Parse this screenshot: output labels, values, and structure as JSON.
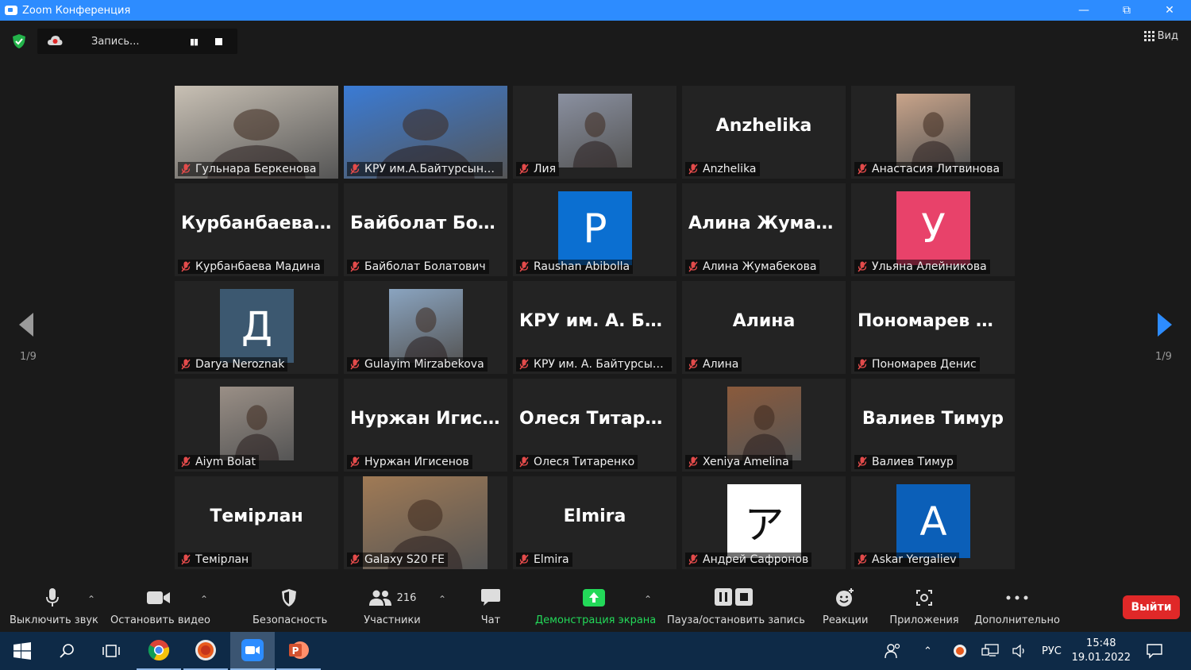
{
  "window": {
    "title": "Zoom Конференция"
  },
  "recording": {
    "label": "Запись..."
  },
  "view": {
    "label": "Вид"
  },
  "pagination": {
    "left": "1/9",
    "right": "1/9"
  },
  "tiles": [
    {
      "name": "Гульнара Беркенова",
      "kind": "photo",
      "bg": "#c8c0b4"
    },
    {
      "name": "КРУ им.А.Байтурсынова Ал...",
      "kind": "photo",
      "bg": "#3a7bd5",
      "active": true
    },
    {
      "name": "Лия",
      "kind": "photo",
      "bg": "#8a90a0"
    },
    {
      "name": "Anzhelika",
      "big": "Anzhelika"
    },
    {
      "name": "Анастасия Литвинова",
      "kind": "photo",
      "bg": "#c9a48a"
    },
    {
      "name": "Курбанбаева Мадина",
      "big": "Курбанбаева..."
    },
    {
      "name": "Байболат Болатович",
      "big": "Байболат  Бола..."
    },
    {
      "name": "Raushan Abibolla",
      "letter": "P",
      "letter_bg": "#0b6fd1"
    },
    {
      "name": "Алина Жумабекова",
      "big": "Алина  Жумабе..."
    },
    {
      "name": "Ульяна Алейникова",
      "letter": "У",
      "letter_bg": "#e8426a"
    },
    {
      "name": "Darya Neroznak",
      "letter": "Д",
      "letter_bg": "#3c5870"
    },
    {
      "name": "Gulayim Mirzabekova",
      "kind": "photo",
      "bg": "#8aa4c0"
    },
    {
      "name": "КРУ им. А. Байтурсынов...",
      "big": "КРУ  им.  А.  Бай..."
    },
    {
      "name": "Алина",
      "big": "Алина"
    },
    {
      "name": "Пономарев Денис",
      "big": "Пономарев  Де..."
    },
    {
      "name": "Aiym Bolat",
      "kind": "photo",
      "bg": "#9a8f86"
    },
    {
      "name": "Нуржан Игисенов",
      "big": "Нуржан  Игисе..."
    },
    {
      "name": "Олеся Титаренко",
      "big": "Олеся  Титаренко"
    },
    {
      "name": "Xeniya Amelina",
      "kind": "photo",
      "bg": "#8a5a3c"
    },
    {
      "name": "Валиев Тимур",
      "big": "Валиев  Тимур"
    },
    {
      "name": "Темірлан",
      "big": "Темірлан"
    },
    {
      "name": "Galaxy S20 FE",
      "kind": "photo",
      "bg": "#a07a55",
      "wide": true
    },
    {
      "name": "Elmira",
      "big": "Elmira"
    },
    {
      "name": "Андрей Сафронов",
      "letter": "ア",
      "letter_bg": "#ffffff",
      "letter_color": "#111"
    },
    {
      "name": "Askar Yergaliev",
      "letter": "A",
      "letter_bg": "#0b5fb8"
    }
  ],
  "toolbar": {
    "mute": "Выключить звук",
    "video": "Остановить видео",
    "security": "Безопасность",
    "participants": "Участники",
    "participants_count": "216",
    "chat": "Чат",
    "share": "Демонстрация экрана",
    "pause_record": "Пауза/остановить запись",
    "reactions": "Реакции",
    "apps": "Приложения",
    "more": "Дополнительно",
    "leave": "Выйти"
  },
  "taskbar": {
    "lang": "РУС",
    "time": "15:48",
    "date": "19.01.2022"
  },
  "colors": {
    "accent": "#2d8cff",
    "share_green": "#23d959",
    "leave_red": "#e02828",
    "active_border": "#e8e67a"
  }
}
